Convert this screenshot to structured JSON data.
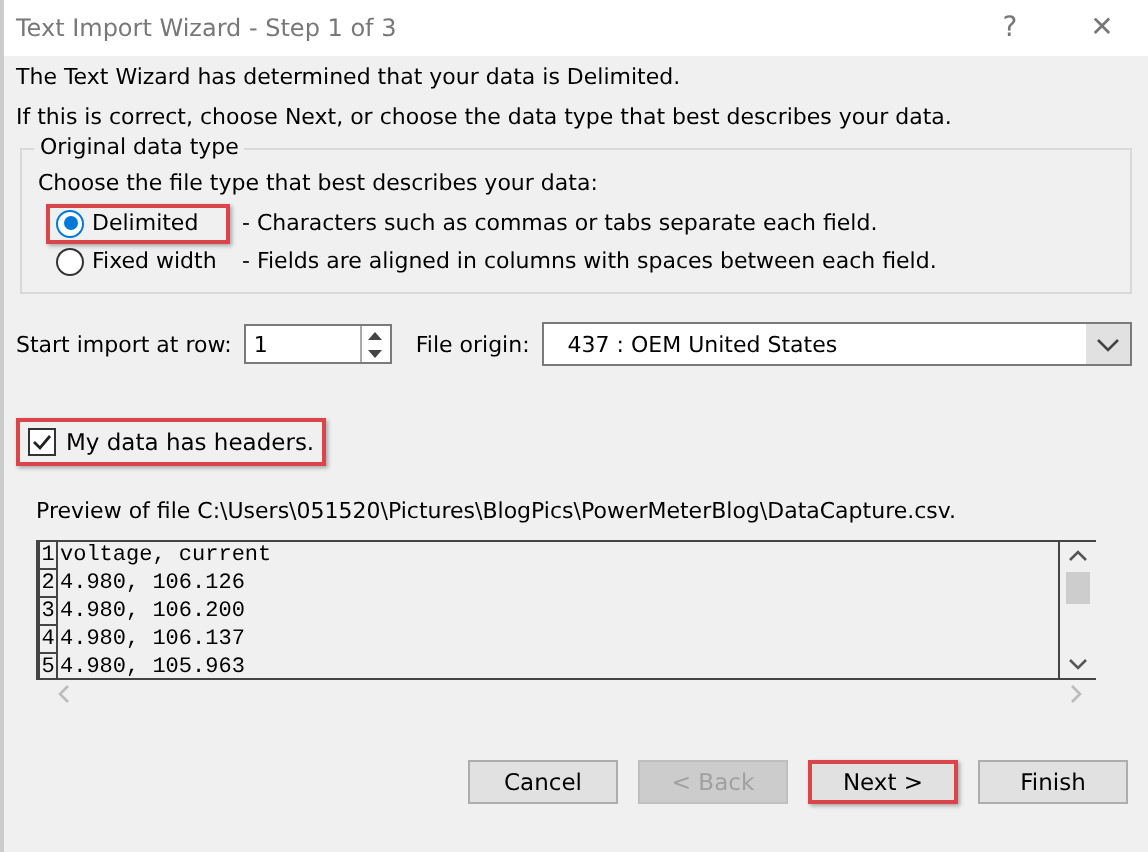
{
  "window": {
    "title": "Text Import Wizard - Step 1 of 3",
    "help": "?",
    "close": "✕"
  },
  "intro": [
    "The Text Wizard has determined that your data is Delimited.",
    "If this is correct, choose Next, or choose the data type that best describes your data."
  ],
  "group": {
    "title": "Original data type",
    "prompt": "Choose the file type that best describes your data:",
    "options": [
      {
        "label": "Delimited",
        "description": "- Characters such as commas or tabs separate each field.",
        "selected": true,
        "highlighted": true
      },
      {
        "label": "Fixed width",
        "description": "- Fields are aligned in columns with spaces between each field.",
        "selected": false,
        "highlighted": false
      }
    ]
  },
  "start_row": {
    "label": "Start import at row:",
    "value": "1"
  },
  "file_origin": {
    "label": "File origin:",
    "value": "437 : OEM United States"
  },
  "headers_checkbox": {
    "label": "My data has headers.",
    "checked": true,
    "highlighted": true
  },
  "preview": {
    "label": "Preview of file C:\\Users\\051520\\Pictures\\BlogPics\\PowerMeterBlog\\DataCapture.csv.",
    "rows": [
      {
        "number": "1",
        "text": "voltage, current"
      },
      {
        "number": "2",
        "text": "4.980, 106.126"
      },
      {
        "number": "3",
        "text": "4.980, 106.200"
      },
      {
        "number": "4",
        "text": "4.980, 106.137"
      },
      {
        "number": "5",
        "text": "4.980, 105.963"
      }
    ]
  },
  "buttons": [
    {
      "label": "Cancel",
      "disabled": false,
      "highlighted": false
    },
    {
      "label": "< Back",
      "disabled": true,
      "highlighted": false
    },
    {
      "label": "Next >",
      "disabled": false,
      "highlighted": true
    },
    {
      "label": "Finish",
      "disabled": false,
      "highlighted": false
    }
  ]
}
